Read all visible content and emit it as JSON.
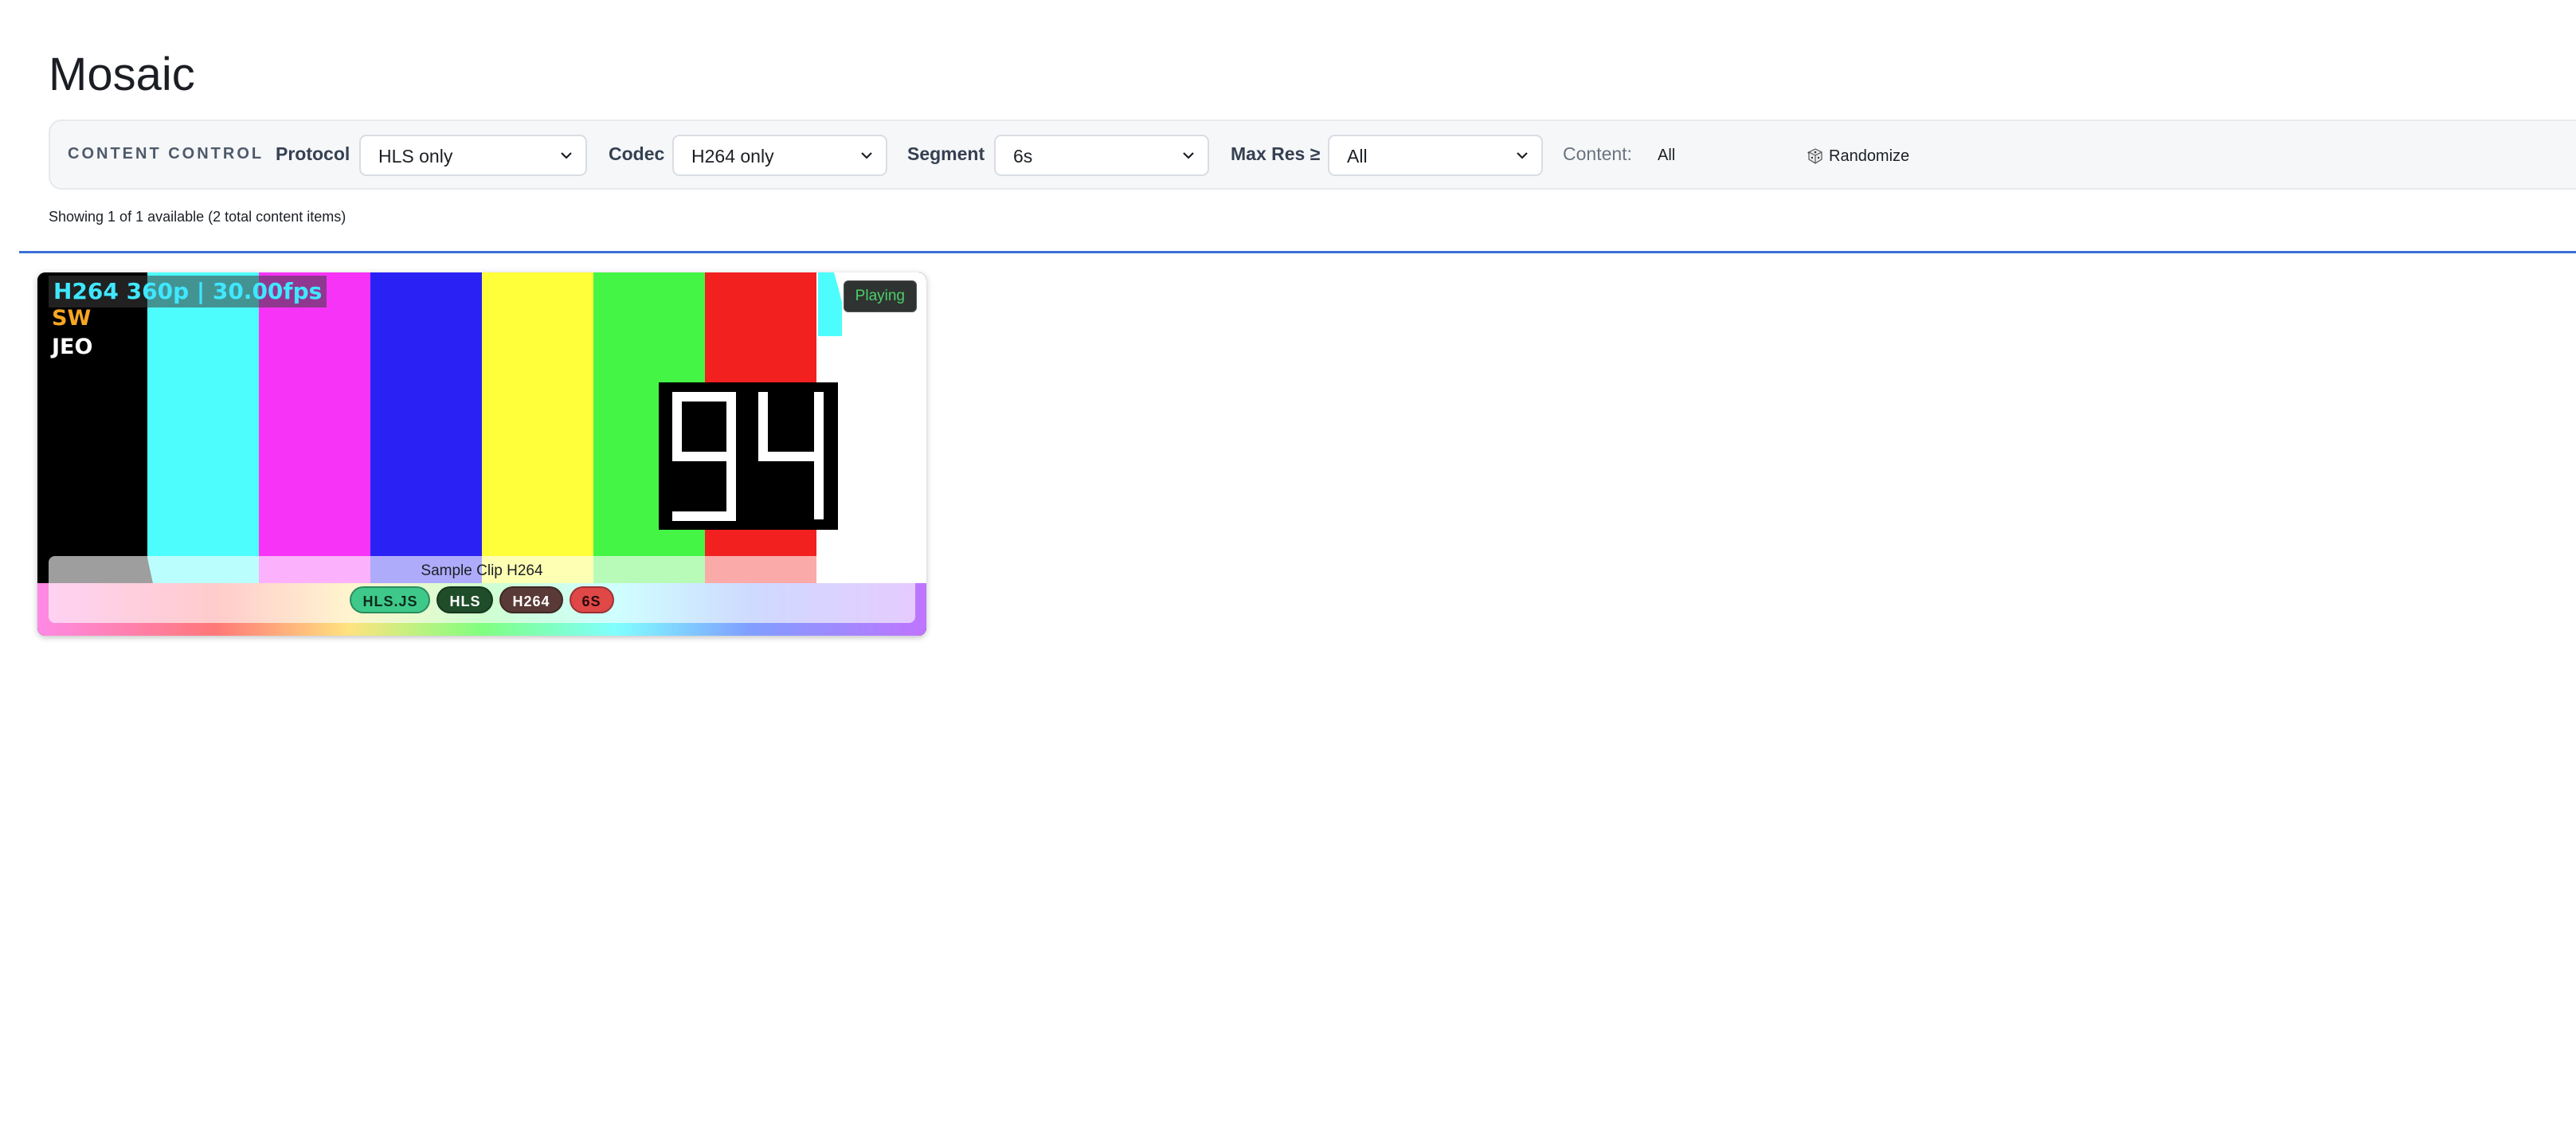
{
  "page": {
    "title": "Mosaic"
  },
  "controls": {
    "section_label": "CONTENT CONTROL",
    "protocol": {
      "label": "Protocol",
      "value": "HLS only"
    },
    "codec": {
      "label": "Codec",
      "value": "H264 only"
    },
    "segment": {
      "label": "Segment",
      "value": "6s"
    },
    "max_res": {
      "label": "Max Res ≥",
      "value": "All"
    },
    "content": {
      "label": "Content:",
      "value": "All"
    },
    "randomize_label": "Randomize"
  },
  "status": {
    "text": "Showing 1 of 1 available (2 total content items)"
  },
  "tiles": [
    {
      "overlay_line1": "H264 360p | 30.00fps",
      "overlay_line2": "SW",
      "overlay_line3": "JEO",
      "counter": "94",
      "state": "Playing",
      "title": "Sample Clip H264",
      "tags": [
        {
          "label": "HLS.JS",
          "bg": "#3ec98a",
          "fg": "#0d2b1c"
        },
        {
          "label": "HLS",
          "bg": "#1f4d2a",
          "fg": "#ffffff"
        },
        {
          "label": "H264",
          "bg": "#5a3a36",
          "fg": "#ffffff"
        },
        {
          "label": "6S",
          "bg": "#e04848",
          "fg": "#2a0a0a"
        }
      ]
    }
  ],
  "colors": {
    "accent_line": "#3b6fd4",
    "playing_text": "#4bd06a"
  }
}
